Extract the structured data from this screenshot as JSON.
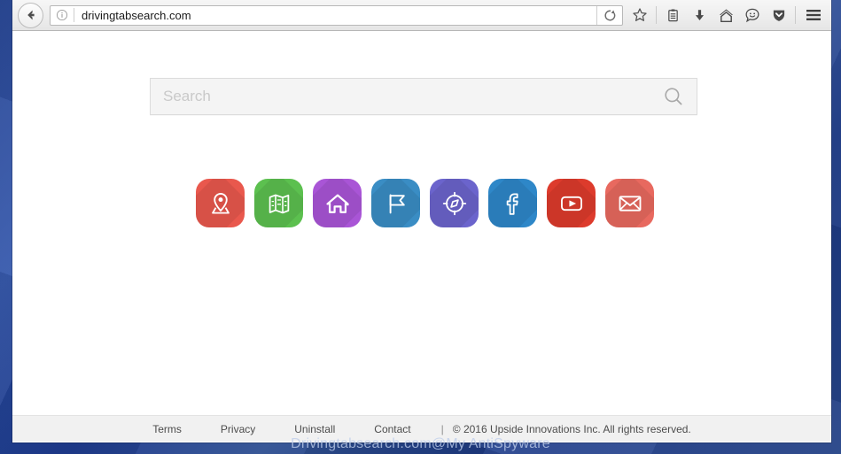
{
  "browser": {
    "back_button": "back-arrow",
    "identity_icon": "info-circle-icon",
    "url": "drivingtabsearch.com",
    "reload_label": "reload-icon",
    "toolbar_icons": [
      {
        "name": "bookmark-star-icon",
        "label": "Bookmark this page"
      },
      {
        "name": "reader-list-icon",
        "label": "Reader / Library"
      },
      {
        "name": "downloads-icon",
        "label": "Downloads"
      },
      {
        "name": "home-icon",
        "label": "Home"
      },
      {
        "name": "chat-smiley-icon",
        "label": "Feedback"
      },
      {
        "name": "pocket-shield-icon",
        "label": "Save to Pocket"
      },
      {
        "name": "hamburger-menu-icon",
        "label": "Open menu"
      }
    ]
  },
  "page": {
    "search": {
      "placeholder": "Search",
      "value": "",
      "button_icon": "search-magnifier-icon"
    },
    "tiles": [
      {
        "name": "location-pin",
        "label": "Location",
        "color": "#e9584d",
        "icon": "map-pin-icon"
      },
      {
        "name": "maps",
        "label": "Maps",
        "color": "#5cc04f",
        "icon": "folded-map-icon"
      },
      {
        "name": "home",
        "label": "Home",
        "color": "#a955d6",
        "icon": "house-icon"
      },
      {
        "name": "flag",
        "label": "Flag",
        "color": "#3a8dc4",
        "icon": "flag-icon"
      },
      {
        "name": "compass",
        "label": "Compass",
        "color": "#6b64cc",
        "icon": "compass-icon"
      },
      {
        "name": "facebook",
        "label": "Facebook",
        "color": "#2e87c8",
        "icon": "facebook-icon"
      },
      {
        "name": "youtube",
        "label": "YouTube",
        "color": "#dd3b2c",
        "icon": "youtube-icon"
      },
      {
        "name": "email",
        "label": "Email",
        "color": "#e8695f",
        "icon": "envelope-icon"
      }
    ],
    "footer": {
      "links": [
        {
          "name": "terms",
          "label": "Terms"
        },
        {
          "name": "privacy",
          "label": "Privacy"
        },
        {
          "name": "uninstall",
          "label": "Uninstall"
        },
        {
          "name": "contact",
          "label": "Contact"
        }
      ],
      "divider": "|",
      "copyright": "© 2016 Upside Innovations Inc. All rights reserved."
    }
  },
  "watermark": "Drivingtabsearch.com@My AntiSpyware"
}
